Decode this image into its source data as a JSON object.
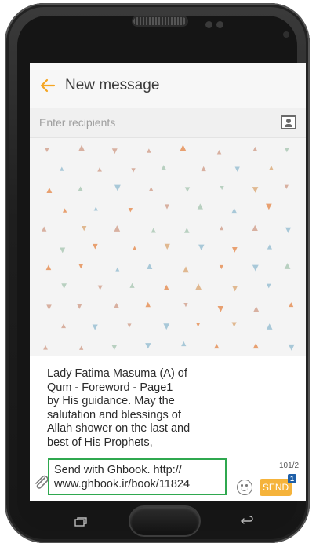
{
  "appbar": {
    "title": "New message"
  },
  "recipients": {
    "placeholder": "Enter recipients"
  },
  "composer": {
    "message_text": "Lady Fatima Masuma (A) of\nQum - Foreword - Page1\nby His guidance. May the\nsalutation and blessings of\nAllah shower on the last and\nbest of His Prophets,",
    "signature_text": "Send with Ghbook. http://\nwww.ghbook.ir/book/11824",
    "char_counter": "101/2",
    "send_label": "SEND",
    "sim_badge": "1"
  },
  "icons": {
    "back": "arrow-left-icon",
    "contact": "contact-card-icon",
    "attach": "paperclip-icon",
    "emoji": "smiley-icon"
  },
  "colors": {
    "accent": "#f5a623",
    "send_button": "#f5b33b",
    "highlight_border": "#2fa84f",
    "sim_badge": "#1e5fa8"
  }
}
